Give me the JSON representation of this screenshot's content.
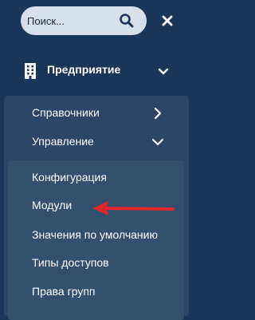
{
  "search": {
    "placeholder": "Поиск..."
  },
  "menu": {
    "section_label": "Предприятие",
    "sub_items": [
      {
        "label": "Справочники"
      },
      {
        "label": "Управление"
      }
    ],
    "nested_items": [
      {
        "label": "Конфигурация"
      },
      {
        "label": "Модули"
      },
      {
        "label": "Значения по умолчанию"
      },
      {
        "label": "Типы доступов"
      },
      {
        "label": "Права групп"
      }
    ]
  },
  "colors": {
    "background": "#1a365b",
    "sub_panel": "#2b4668",
    "nested_panel": "#34506f",
    "search_bg": "#d7e0ea",
    "annotation_arrow": "#e0262b"
  },
  "icons": [
    "search-icon",
    "close-icon",
    "building-icon",
    "chevron-down-icon",
    "chevron-right-icon"
  ]
}
